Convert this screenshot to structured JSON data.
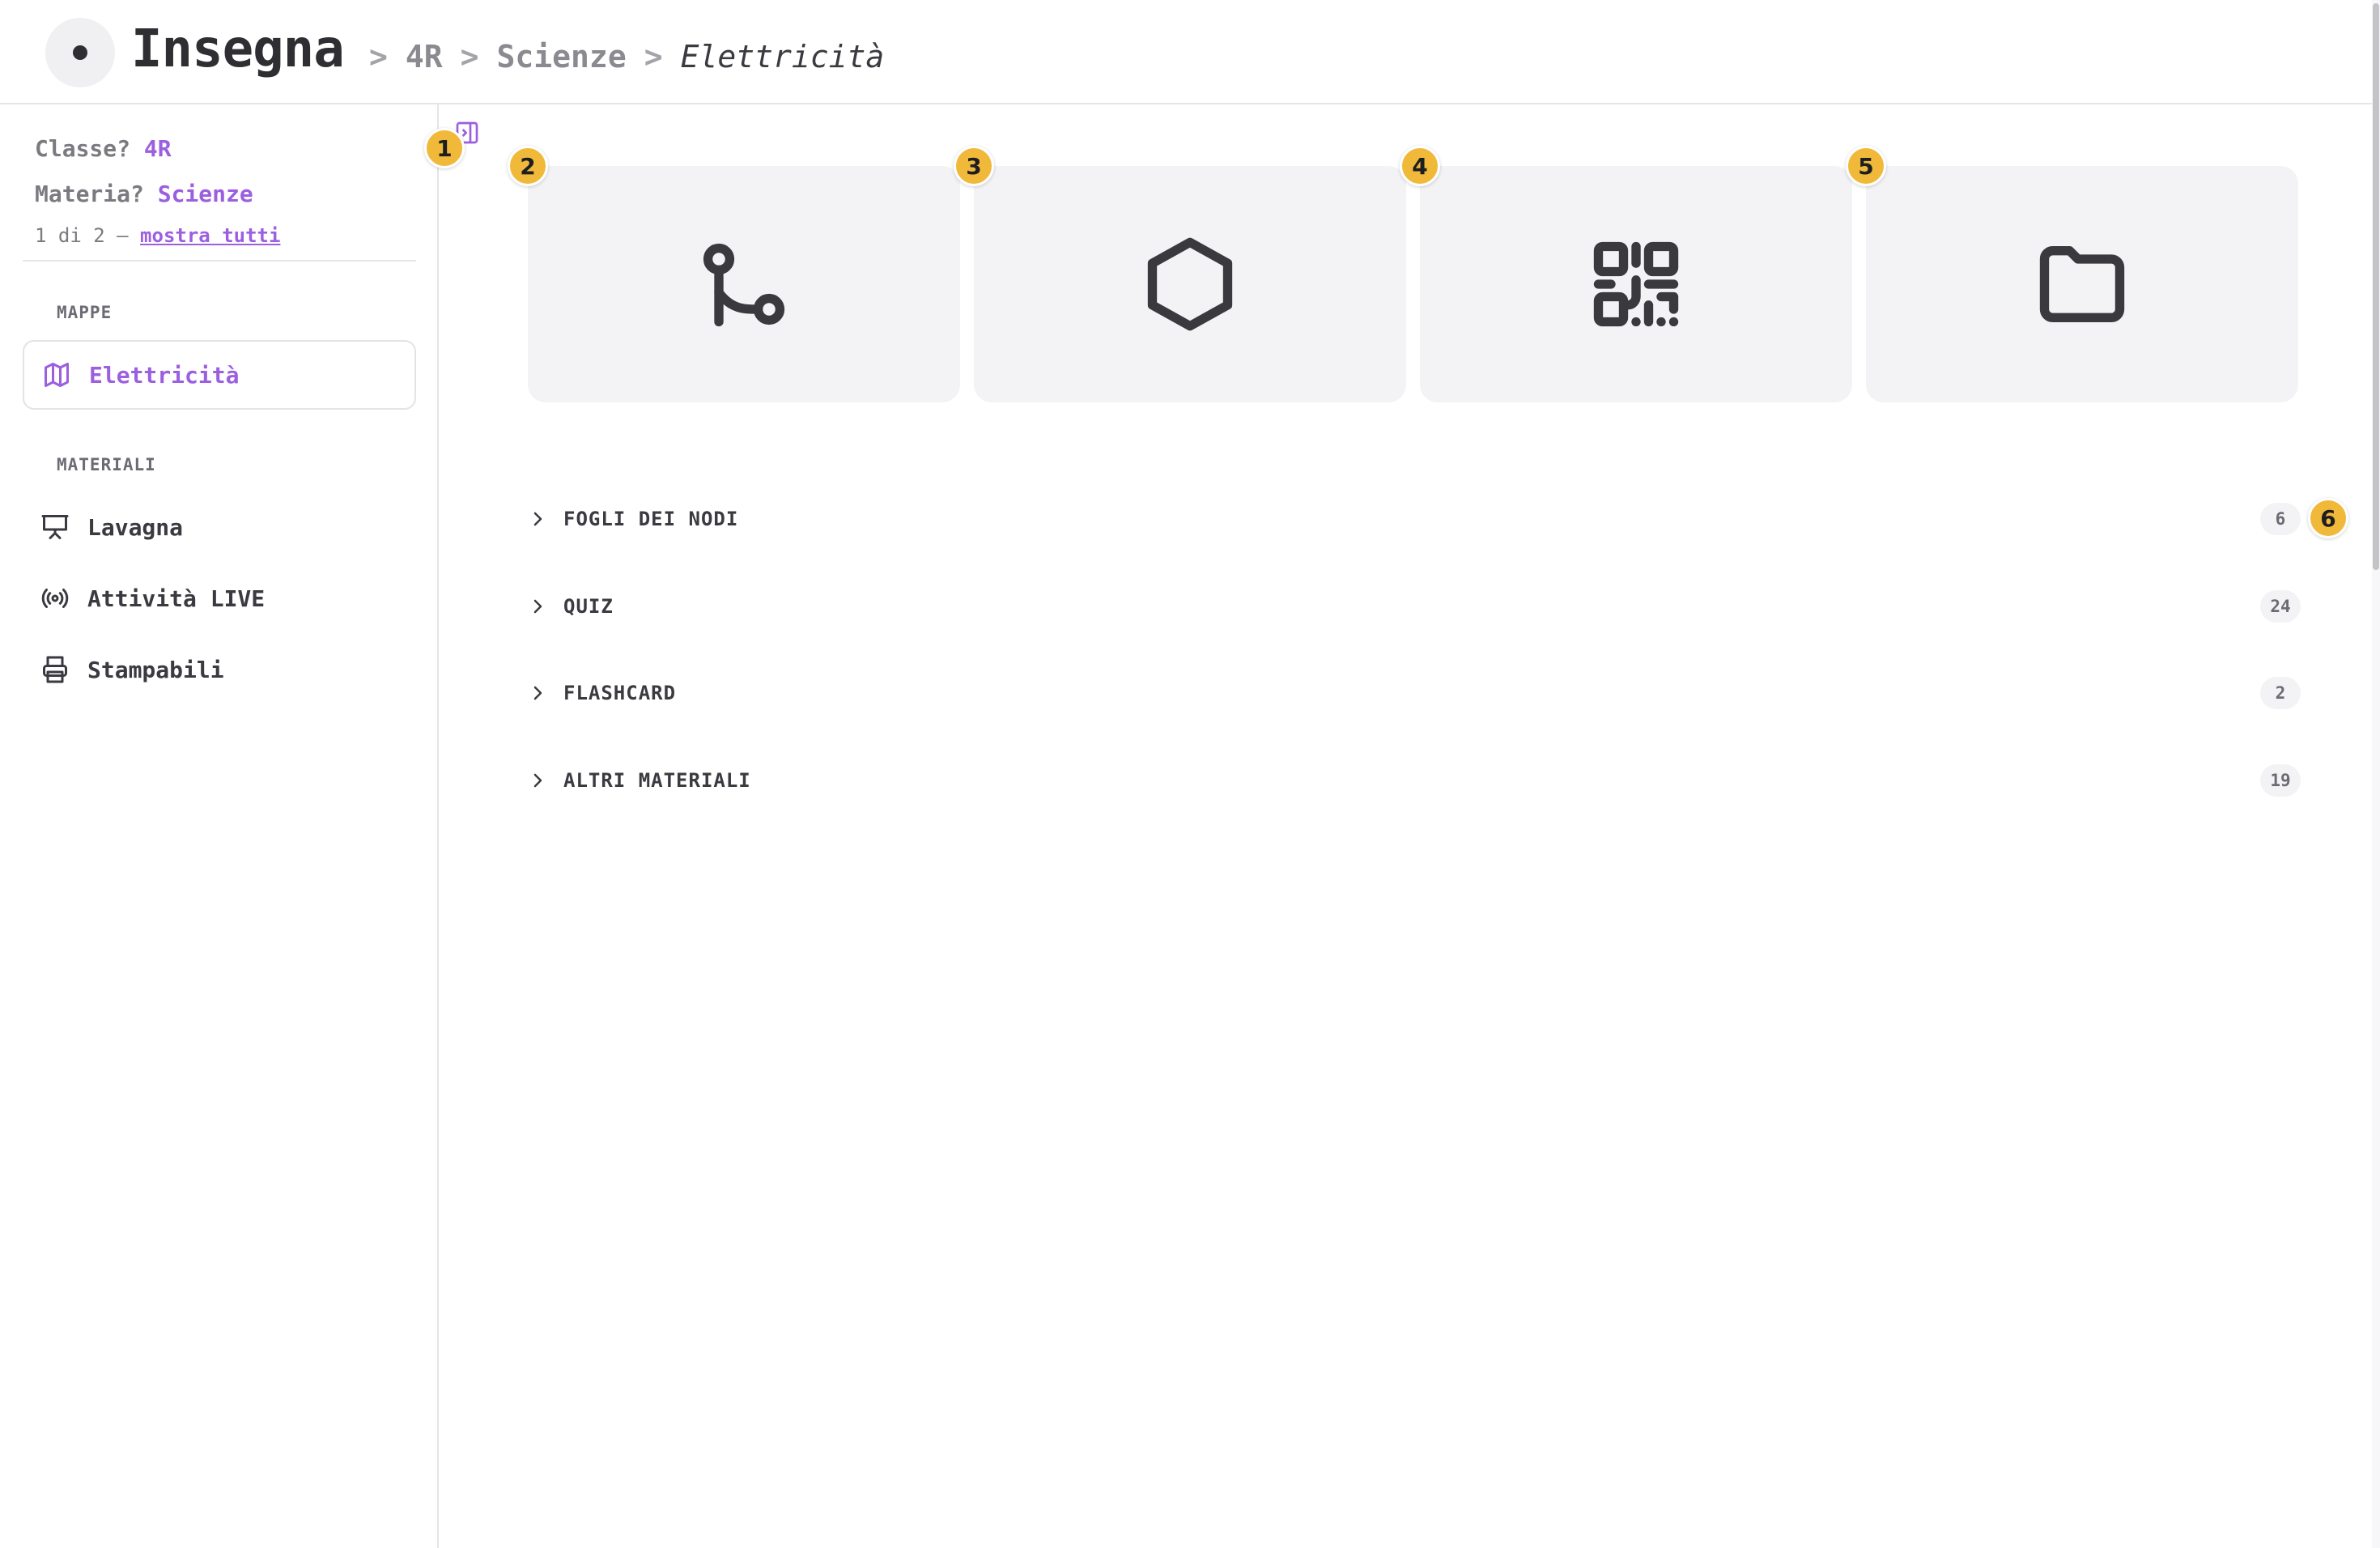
{
  "header": {
    "app_title": "Insegna",
    "separator": ">",
    "breadcrumb": [
      "4R",
      "Scienze",
      "Elettricità"
    ]
  },
  "sidebar": {
    "class_label": "Classe?",
    "class_value": "4R",
    "subject_label": "Materia?",
    "subject_value": "Scienze",
    "count_text": "1 di 2 —",
    "show_all": "mostra tutti",
    "maps_heading": "MAPPE",
    "maps": [
      {
        "label": "Elettricità",
        "icon": "map-icon"
      }
    ],
    "materials_heading": "MATERIALI",
    "materials": [
      {
        "label": "Lavagna",
        "icon": "presentation-board-icon"
      },
      {
        "label": "Attività LIVE",
        "icon": "broadcast-icon"
      },
      {
        "label": "Stampabili",
        "icon": "printer-icon"
      }
    ]
  },
  "badges": [
    "1",
    "2",
    "3",
    "4",
    "5",
    "6"
  ],
  "cards": [
    {
      "icon": "node-path-icon"
    },
    {
      "icon": "hexagon-icon"
    },
    {
      "icon": "qr-code-icon"
    },
    {
      "icon": "folder-icon"
    }
  ],
  "sections": [
    {
      "label": "FOGLI DEI NODI",
      "count": "6"
    },
    {
      "label": "QUIZ",
      "count": "24"
    },
    {
      "label": "FLASHCARD",
      "count": "2"
    },
    {
      "label": "ALTRI MATERIALI",
      "count": "19"
    }
  ],
  "colors": {
    "accent": "#9b5fe0",
    "badge": "#f0b93a",
    "text": "#2f2f33",
    "card_bg": "#f3f3f6"
  }
}
